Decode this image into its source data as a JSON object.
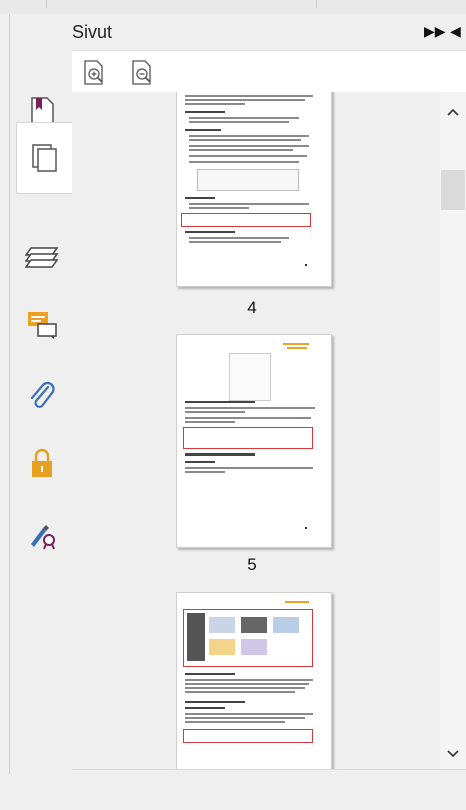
{
  "panel": {
    "title": "Sivut"
  },
  "header_controls": {
    "expand_icon": "double-chevron-right-icon",
    "collapse_icon": "triangle-left-icon"
  },
  "toolbar": {
    "zoom_in_icon": "page-zoom-in-icon",
    "zoom_out_icon": "page-zoom-out-icon"
  },
  "sidebar": {
    "items": [
      {
        "icon": "bookmark-icon"
      },
      {
        "icon": "pages-icon",
        "active": true
      },
      {
        "icon": "layers-icon"
      },
      {
        "icon": "comments-icon"
      },
      {
        "icon": "attachment-icon"
      },
      {
        "icon": "lock-icon"
      },
      {
        "icon": "signature-icon"
      }
    ]
  },
  "pages": [
    {
      "number": "4"
    },
    {
      "number": "5"
    },
    {
      "number": ""
    }
  ],
  "colors": {
    "accent": "#7b1f5a",
    "highlight_red": "#d9363e",
    "comment_orange": "#f0a020",
    "lock_orange": "#e8a020"
  }
}
